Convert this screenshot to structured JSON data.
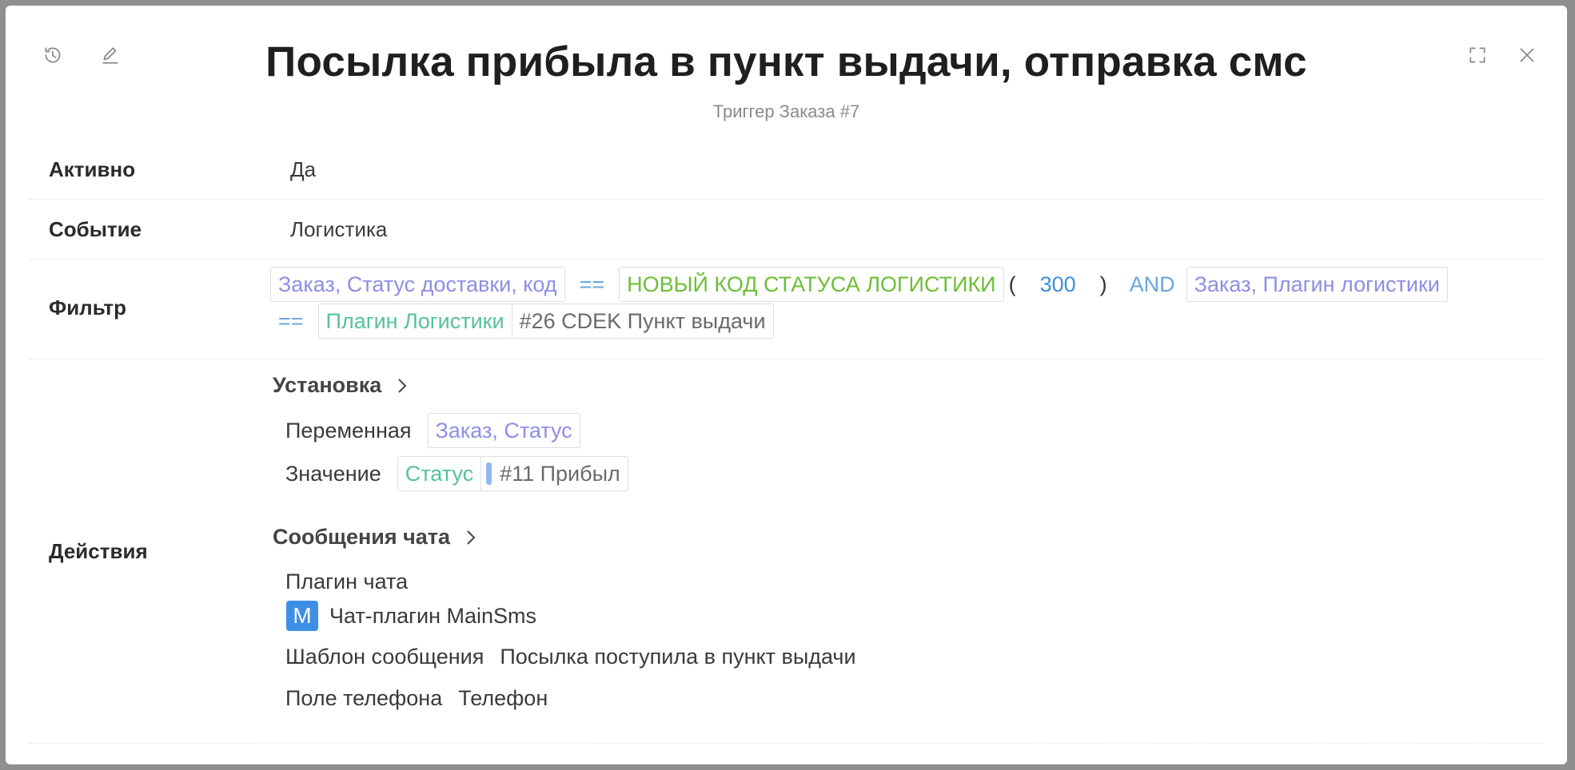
{
  "header": {
    "title": "Посылка прибыла в пункт выдачи, отправка смс",
    "subtitle": "Триггер Заказа #7",
    "history_icon": "history-icon",
    "edit_icon": "edit-icon",
    "expand_icon": "expand-icon",
    "close_icon": "close-icon"
  },
  "fields": {
    "active": {
      "label": "Активно",
      "value": "Да"
    },
    "event": {
      "label": "Событие",
      "value": "Логистика"
    },
    "filter": {
      "label": "Фильтр",
      "var1": "Заказ, Статус доставки, код",
      "op1": "==",
      "const1": "НОВЫЙ КОД СТАТУСА ЛОГИСТИКИ",
      "paren_open": "(",
      "num1": "300",
      "paren_close": ")",
      "and": "AND",
      "var2": "Заказ, Плагин логистики",
      "op2": "==",
      "plugin_label": "Плагин Логистики",
      "plugin_value": "#26 CDEK Пункт выдачи"
    },
    "actions": {
      "label": "Действия",
      "set": {
        "title": "Установка",
        "variable_label": "Переменная",
        "variable_value": "Заказ, Статус",
        "value_label": "Значение",
        "value_chip": "Статус",
        "value_value": "#11 Прибыл"
      },
      "chat": {
        "title": "Сообщения чата",
        "plugin_label": "Плагин чата",
        "plugin_badge": "M",
        "plugin_name": "Чат-плагин MainSms",
        "template_label": "Шаблон сообщения",
        "template_value": "Посылка поступила в пункт выдачи",
        "phone_label": "Поле телефона",
        "phone_value": "Телефон"
      }
    }
  },
  "colors": {
    "variable": "#8e8ee6",
    "constant": "#6cbf36",
    "plugin": "#55c29c",
    "operator": "#6aa6de",
    "number": "#3d8fd6",
    "badge": "#3d8fe6"
  }
}
